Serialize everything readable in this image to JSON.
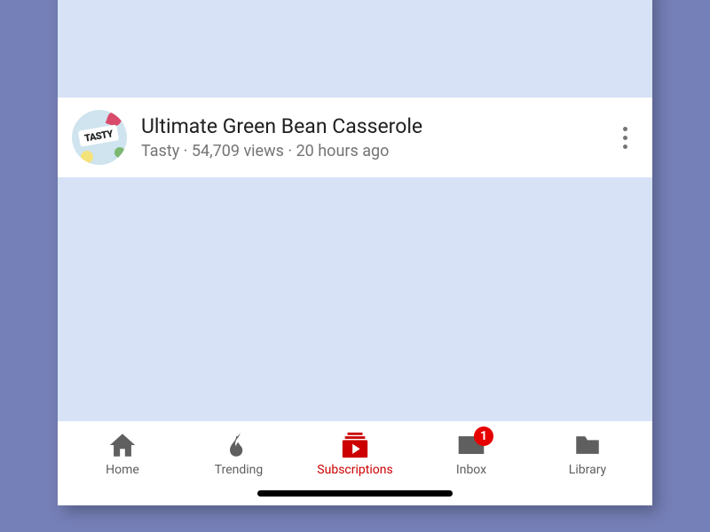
{
  "video": {
    "channel_badge_text": "TASTY",
    "title": "Ultimate Green Bean Casserole",
    "channel": "Tasty",
    "views": "54,709 views",
    "age": "20 hours ago",
    "separator": " · "
  },
  "inbox_badge": "1",
  "nav": {
    "home": "Home",
    "trending": "Trending",
    "subscriptions": "Subscriptions",
    "inbox": "Inbox",
    "library": "Library"
  },
  "colors": {
    "active": "#cc0000",
    "icon": "#5f5f5f"
  }
}
